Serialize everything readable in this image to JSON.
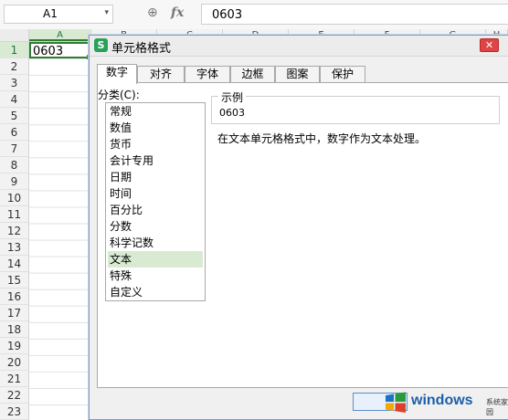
{
  "formula_bar": {
    "name_box": "A1",
    "name_box_caret": "▾",
    "zoom_icon": "⊕",
    "fx_label": "fx",
    "value": "0603"
  },
  "sheet": {
    "columns": [
      "A",
      "B",
      "C",
      "D",
      "E",
      "F",
      "G",
      "H"
    ],
    "rows": [
      "1",
      "2",
      "3",
      "4",
      "5",
      "6",
      "7",
      "8",
      "9",
      "10",
      "11",
      "12",
      "13",
      "14",
      "15",
      "16",
      "17",
      "18",
      "19",
      "20",
      "21",
      "22",
      "23"
    ],
    "active_cell_value": "0603",
    "accent_color": "#2e7d32"
  },
  "dialog": {
    "title": "单元格格式",
    "close_glyph": "✕",
    "app_icon_letter": "S",
    "tabs": [
      "数字",
      "对齐",
      "字体",
      "边框",
      "图案",
      "保护"
    ],
    "category_label": "分类(C):",
    "categories": [
      "常规",
      "数值",
      "货币",
      "会计专用",
      "日期",
      "时间",
      "百分比",
      "分数",
      "科学记数",
      "文本",
      "特殊",
      "自定义"
    ],
    "selected_category": "文本",
    "sample_legend": "示例",
    "sample_value": "0603",
    "description": "在文本单元格格式中，数字作为文本处理。"
  },
  "watermark": {
    "brand": "windows",
    "sub": "系统家园"
  }
}
